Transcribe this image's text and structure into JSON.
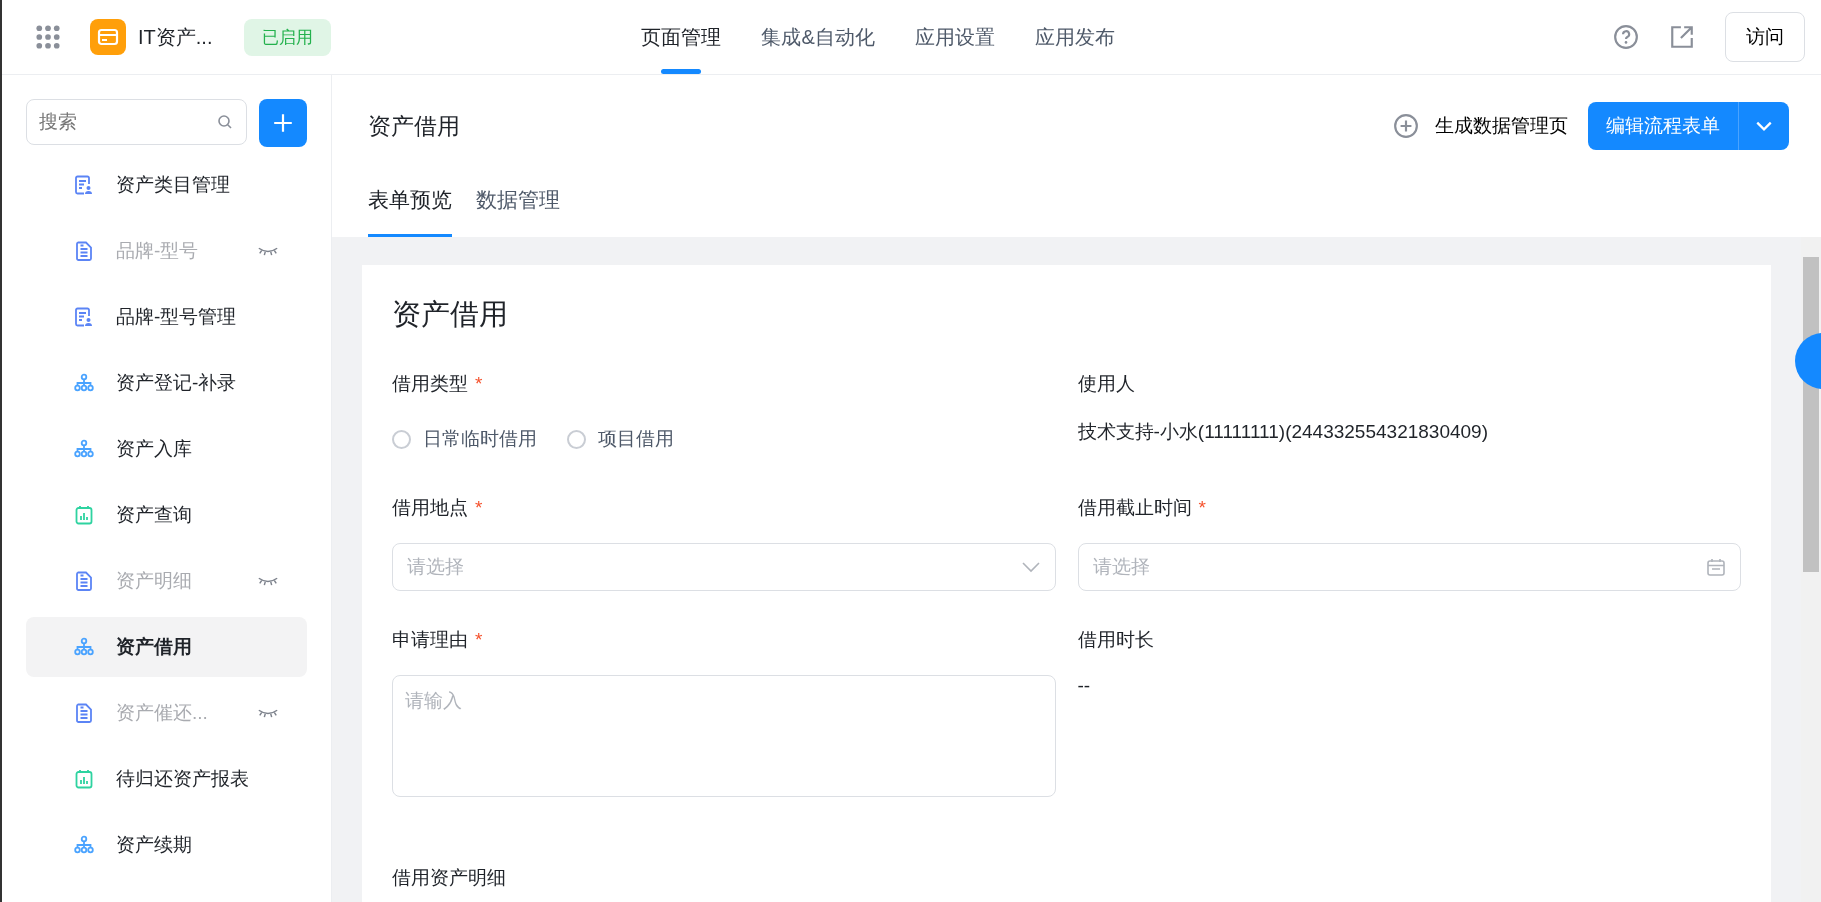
{
  "app": {
    "name": "IT资产...",
    "status": "已启用"
  },
  "nav_tabs": [
    {
      "label": "页面管理",
      "selected": true
    },
    {
      "label": "集成&自动化",
      "selected": false
    },
    {
      "label": "应用设置",
      "selected": false
    },
    {
      "label": "应用发布",
      "selected": false
    }
  ],
  "visit_button": "访问",
  "sidebar": {
    "search": {
      "placeholder": "搜索"
    },
    "items": [
      {
        "label": "资产类目管理",
        "kind": "form-manage",
        "hidden": false,
        "selected": false
      },
      {
        "label": "品牌-型号",
        "kind": "form",
        "hidden": true,
        "selected": false
      },
      {
        "label": "品牌-型号管理",
        "kind": "form-manage",
        "hidden": false,
        "selected": false
      },
      {
        "label": "资产登记-补录",
        "kind": "flow",
        "hidden": false,
        "selected": false
      },
      {
        "label": "资产入库",
        "kind": "flow",
        "hidden": false,
        "selected": false
      },
      {
        "label": "资产查询",
        "kind": "report",
        "hidden": false,
        "selected": false
      },
      {
        "label": "资产明细",
        "kind": "form",
        "hidden": true,
        "selected": false
      },
      {
        "label": "资产借用",
        "kind": "flow",
        "hidden": false,
        "selected": true
      },
      {
        "label": "资产催还...",
        "kind": "form",
        "hidden": true,
        "selected": false
      },
      {
        "label": "待归还资产报表",
        "kind": "report",
        "hidden": false,
        "selected": false
      },
      {
        "label": "资产续期",
        "kind": "flow",
        "hidden": false,
        "selected": false
      }
    ]
  },
  "page": {
    "title": "资产借用",
    "generate_link": "生成数据管理页",
    "edit_button": "编辑流程表单",
    "tabs": [
      {
        "label": "表单预览",
        "selected": true
      },
      {
        "label": "数据管理",
        "selected": false
      }
    ]
  },
  "form": {
    "title": "资产借用",
    "fields": [
      {
        "label": "借用类型",
        "required": "*",
        "kind": "radio",
        "options": [
          {
            "label": "日常临时借用",
            "selected": false
          },
          {
            "label": "项目借用",
            "selected": false
          }
        ]
      },
      {
        "label": "使用人",
        "kind": "text",
        "value": "技术支持-小水(11111111)(244332554321830409)"
      },
      {
        "label": "借用地点",
        "required": "*",
        "kind": "select",
        "placeholder": "请选择"
      },
      {
        "label": "借用截止时间",
        "required": "*",
        "kind": "date",
        "placeholder": "请选择"
      },
      {
        "label": "申请理由",
        "required": "*",
        "kind": "textarea",
        "placeholder": "请输入"
      },
      {
        "label": "借用时长",
        "kind": "text",
        "value": "--"
      }
    ],
    "section_label": "借用资产明细"
  }
}
